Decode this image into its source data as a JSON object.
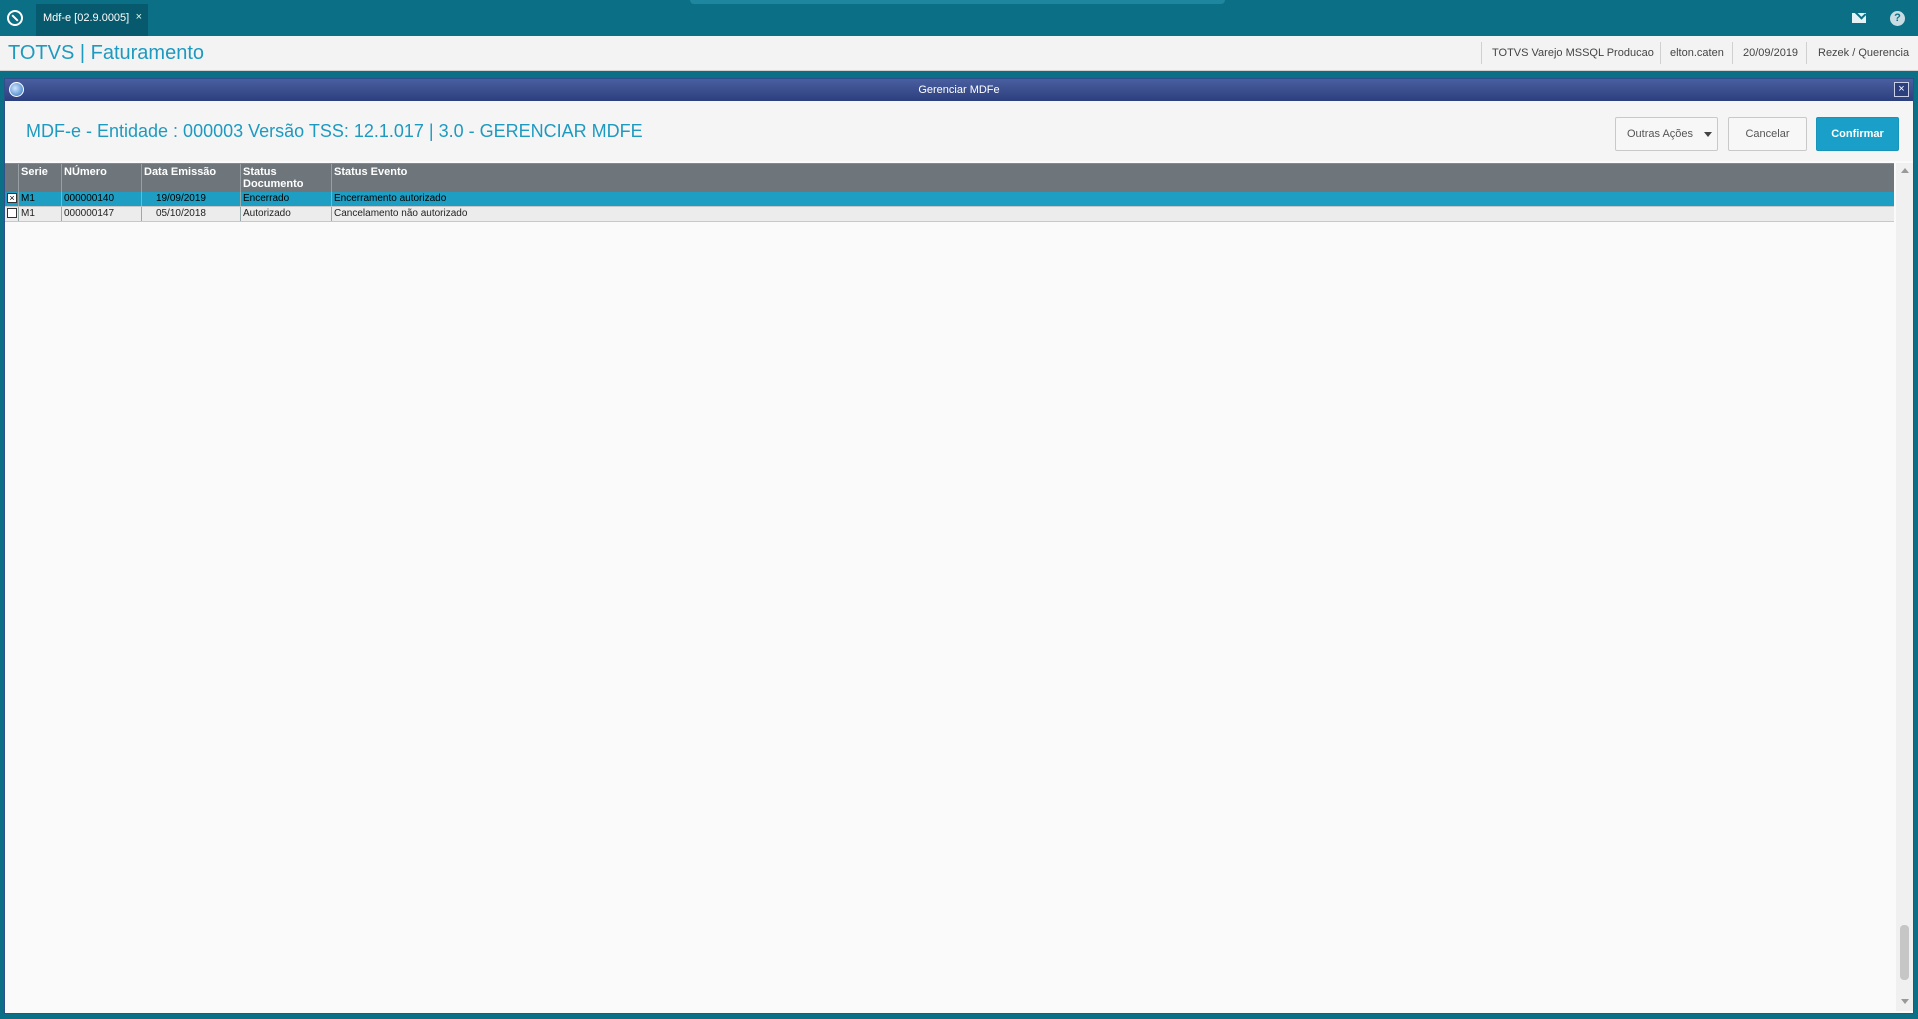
{
  "tabbar": {
    "tab_label": "Mdf-e [02.9.0005]",
    "tab_close": "×"
  },
  "header": {
    "app_title": "TOTVS | Faturamento",
    "environment": "TOTVS Varejo MSSQL Producao",
    "user": "elton.caten",
    "date": "20/09/2019",
    "branch": "Rezek / Querencia"
  },
  "dialog": {
    "title": "Gerenciar MDFe",
    "heading": "MDF-e - Entidade : 000003 Versão TSS: 12.1.017 | 3.0 - GERENCIAR MDFE",
    "btn_other": "Outras Ações",
    "btn_cancel": "Cancelar",
    "btn_confirm": "Confirmar"
  },
  "grid": {
    "columns": [
      "Serie",
      "NÚmero",
      "Data Emissão",
      "Status Documento",
      "Status Evento"
    ],
    "rows": [
      {
        "checked": true,
        "check_mark": "×",
        "serie": "M1",
        "numero": "000000140",
        "data": "19/09/2019",
        "status_doc": "Encerrado",
        "status_evento": "Encerramento autorizado"
      },
      {
        "checked": false,
        "check_mark": "",
        "serie": "M1",
        "numero": "000000147",
        "data": "05/10/2018",
        "status_doc": "Autorizado",
        "status_evento": "Cancelamento não autorizado"
      }
    ]
  },
  "icons": {
    "mail": "mail-icon",
    "help": "help-icon",
    "help_glyph": "?"
  },
  "colors": {
    "topbar": "#0b6f85",
    "accent": "#1e9ac0",
    "selected_row": "#1f9ec4",
    "confirm_button": "#1aa0c8"
  }
}
